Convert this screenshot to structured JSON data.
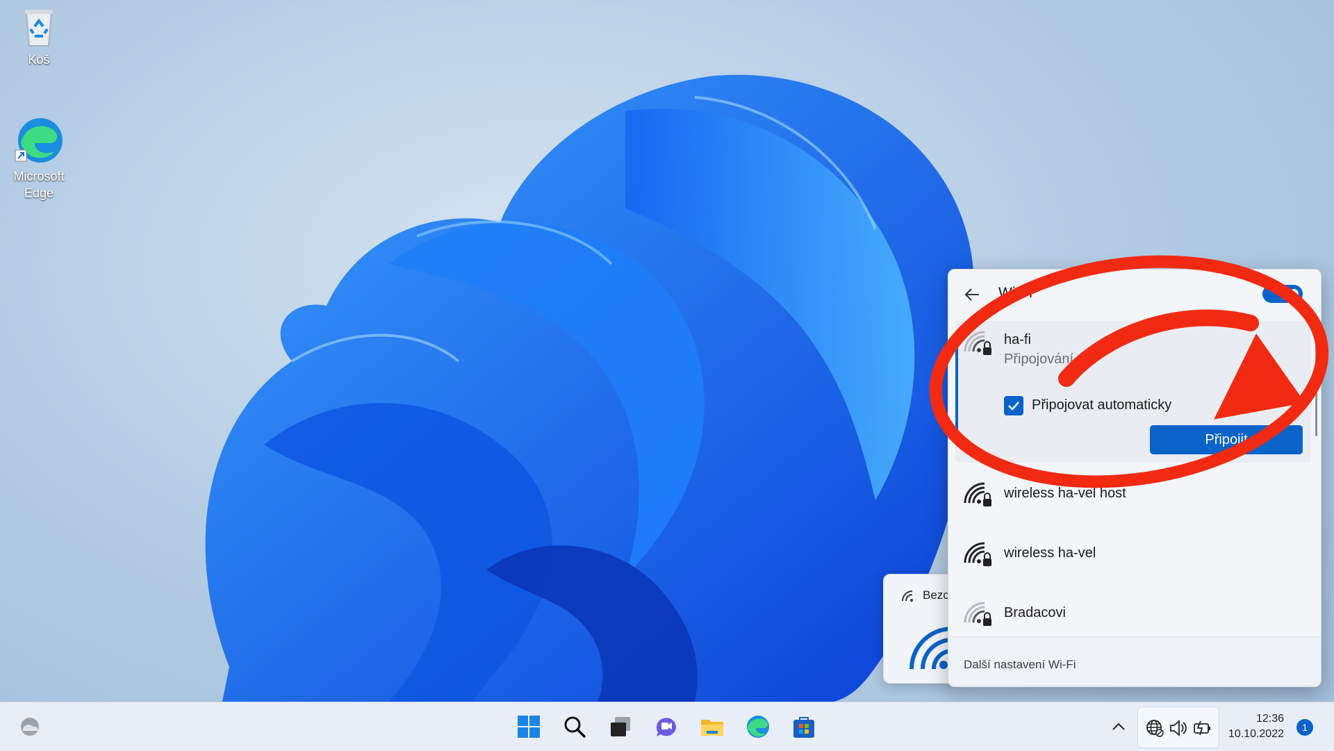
{
  "desktop": {
    "icons": [
      {
        "label": "Koš"
      },
      {
        "label": "Microsoft Edge"
      }
    ]
  },
  "quick_settings_card": {
    "label": "Bezc"
  },
  "wifi_flyout": {
    "title": "Wi-Fi",
    "wifi_enabled": true,
    "selected_network": {
      "name": "ha-fi",
      "status": "Připojování",
      "auto_connect_label": "Připojovat automaticky",
      "auto_connect_checked": true,
      "connect_label": "Připojit"
    },
    "networks": [
      {
        "name": "wireless ha-vel host",
        "icon": "wifi-secured-icon"
      },
      {
        "name": "wireless ha-vel",
        "icon": "wifi-secured-icon"
      },
      {
        "name": "Bradacovi",
        "icon": "wifi-secured-weak-icon"
      }
    ],
    "footer_link": "Další nastavení Wi-Fi"
  },
  "taskbar": {
    "apps": [
      "start-icon",
      "search-icon",
      "task-view-icon",
      "chat-icon",
      "file-explorer-icon",
      "edge-icon",
      "store-icon"
    ],
    "clock_time": "12:36",
    "clock_date": "10.10.2022",
    "notification_count": "1"
  },
  "colors": {
    "accent": "#0a63c9",
    "annotation": "#f22a12"
  }
}
